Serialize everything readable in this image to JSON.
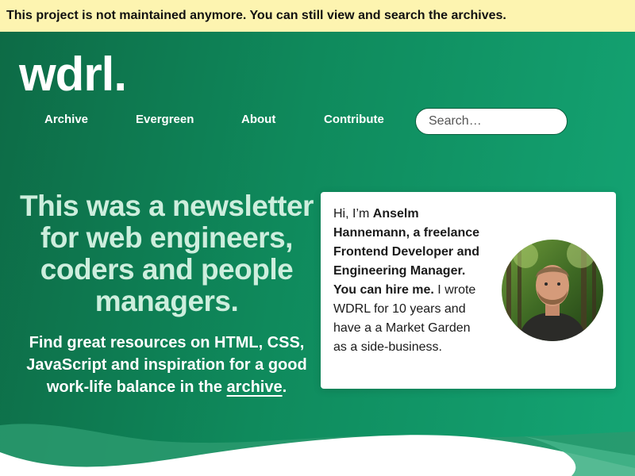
{
  "notice": "This project is not maintained anymore. You can still view and search the archives.",
  "logo": "wdrl.",
  "nav": {
    "items": [
      {
        "label": "Archive"
      },
      {
        "label": "Evergreen"
      },
      {
        "label": "About"
      },
      {
        "label": "Contribute"
      }
    ],
    "search_placeholder": "Search…"
  },
  "hero": {
    "headline": "This was a newsletter for web engineers, coders and people managers.",
    "sub_before": "Find great resources on HTML, CSS, JavaScript and inspiration for a good work-life balance in the ",
    "sub_link": "archive",
    "sub_after": "."
  },
  "card": {
    "intro": "Hi, I’m ",
    "bold": "Anselm Hannemann, a freelance Frontend Developer and Engineering Manager. You can hire me.",
    "rest": " I wrote WDRL for 10 years and have a a Market Garden as a side-business.",
    "avatar_icon": "portrait-photo"
  },
  "colors": {
    "notice_bg": "#fdf4b0",
    "hero_dark": "#0d6b46",
    "hero_light": "#14a574",
    "headline": "#cdeedd"
  }
}
